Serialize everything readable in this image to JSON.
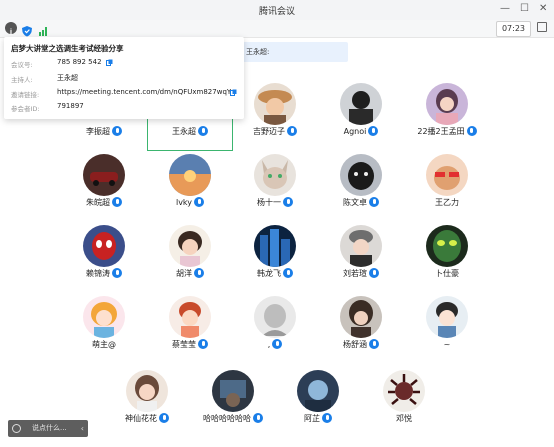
{
  "window": {
    "title": "腾讯会议"
  },
  "toolbar": {
    "timer": "07:23"
  },
  "meeting_info": {
    "heading": "启梦大讲堂之选调生考试经验分享",
    "rows": [
      {
        "label": "会议号:",
        "value": "785 892 542",
        "copy": true
      },
      {
        "label": "主持人:",
        "value": "王永超",
        "copy": false
      },
      {
        "label": "邀请链接:",
        "value": "https://meeting.tencent.com/dm/nQFUxm827wqY",
        "copy": true
      },
      {
        "label": "参会者ID:",
        "value": "791897",
        "copy": false
      }
    ]
  },
  "banner": {
    "text": "王永超:"
  },
  "participants": [
    {
      "name": "李振超",
      "avatar": "partial",
      "mic": true
    },
    {
      "name": "王永超",
      "avatar": "partial",
      "mic": true,
      "active": true
    },
    {
      "name": "吉野迈子",
      "avatar": "woman-hat",
      "mic": true
    },
    {
      "name": "Agnoi",
      "avatar": "dark-man",
      "mic": true
    },
    {
      "name": "22播2王孟田",
      "avatar": "girl-purple",
      "mic": true
    },
    {
      "name": "朱皖超",
      "avatar": "car",
      "mic": true
    },
    {
      "name": "lvky",
      "avatar": "sunset",
      "mic": true
    },
    {
      "name": "杨十一",
      "avatar": "sphynx-cat",
      "mic": true
    },
    {
      "name": "陈文卓",
      "avatar": "black-dog",
      "mic": true
    },
    {
      "name": "王乙力",
      "avatar": "sunglasses-dog",
      "mic": false
    },
    {
      "name": "赖锦涛",
      "avatar": "spiderman",
      "mic": true
    },
    {
      "name": "胡洋",
      "avatar": "little-girl",
      "mic": true
    },
    {
      "name": "韩龙飞",
      "avatar": "blue-buildings",
      "mic": true
    },
    {
      "name": "刘若瑄",
      "avatar": "girl-beanie",
      "mic": true
    },
    {
      "name": "卜仕豪",
      "avatar": "green-face",
      "mic": false
    },
    {
      "name": "萌主@",
      "avatar": "anime-girl",
      "mic": false
    },
    {
      "name": "蔡莹莹",
      "avatar": "cartoon-girl",
      "mic": true
    },
    {
      "name": ",",
      "avatar": "gray-sketch",
      "mic": true
    },
    {
      "name": "杨舒涵",
      "avatar": "girl-dark",
      "mic": true
    },
    {
      "name": "~",
      "avatar": "anime-boy",
      "mic": false
    },
    {
      "name": "神仙花花",
      "avatar": "girl-smile",
      "mic": true
    },
    {
      "name": "哈哈哈哈哈哈",
      "avatar": "dark-room",
      "mic": true
    },
    {
      "name": "阿芷",
      "avatar": "blue-photo",
      "mic": true
    },
    {
      "name": "邓悦",
      "avatar": "medusa",
      "mic": false
    }
  ],
  "chat": {
    "placeholder": "说点什么..."
  },
  "icons": {
    "info": "info-icon",
    "shield": "shield-icon",
    "signal": "signal-icon",
    "copy": "copy-icon",
    "mic": "microphone-icon",
    "fullscreen": "fullscreen-icon"
  },
  "colors": {
    "accent": "#1a7ee8",
    "active_border": "#3bb56f",
    "signal": "#2fb457"
  }
}
